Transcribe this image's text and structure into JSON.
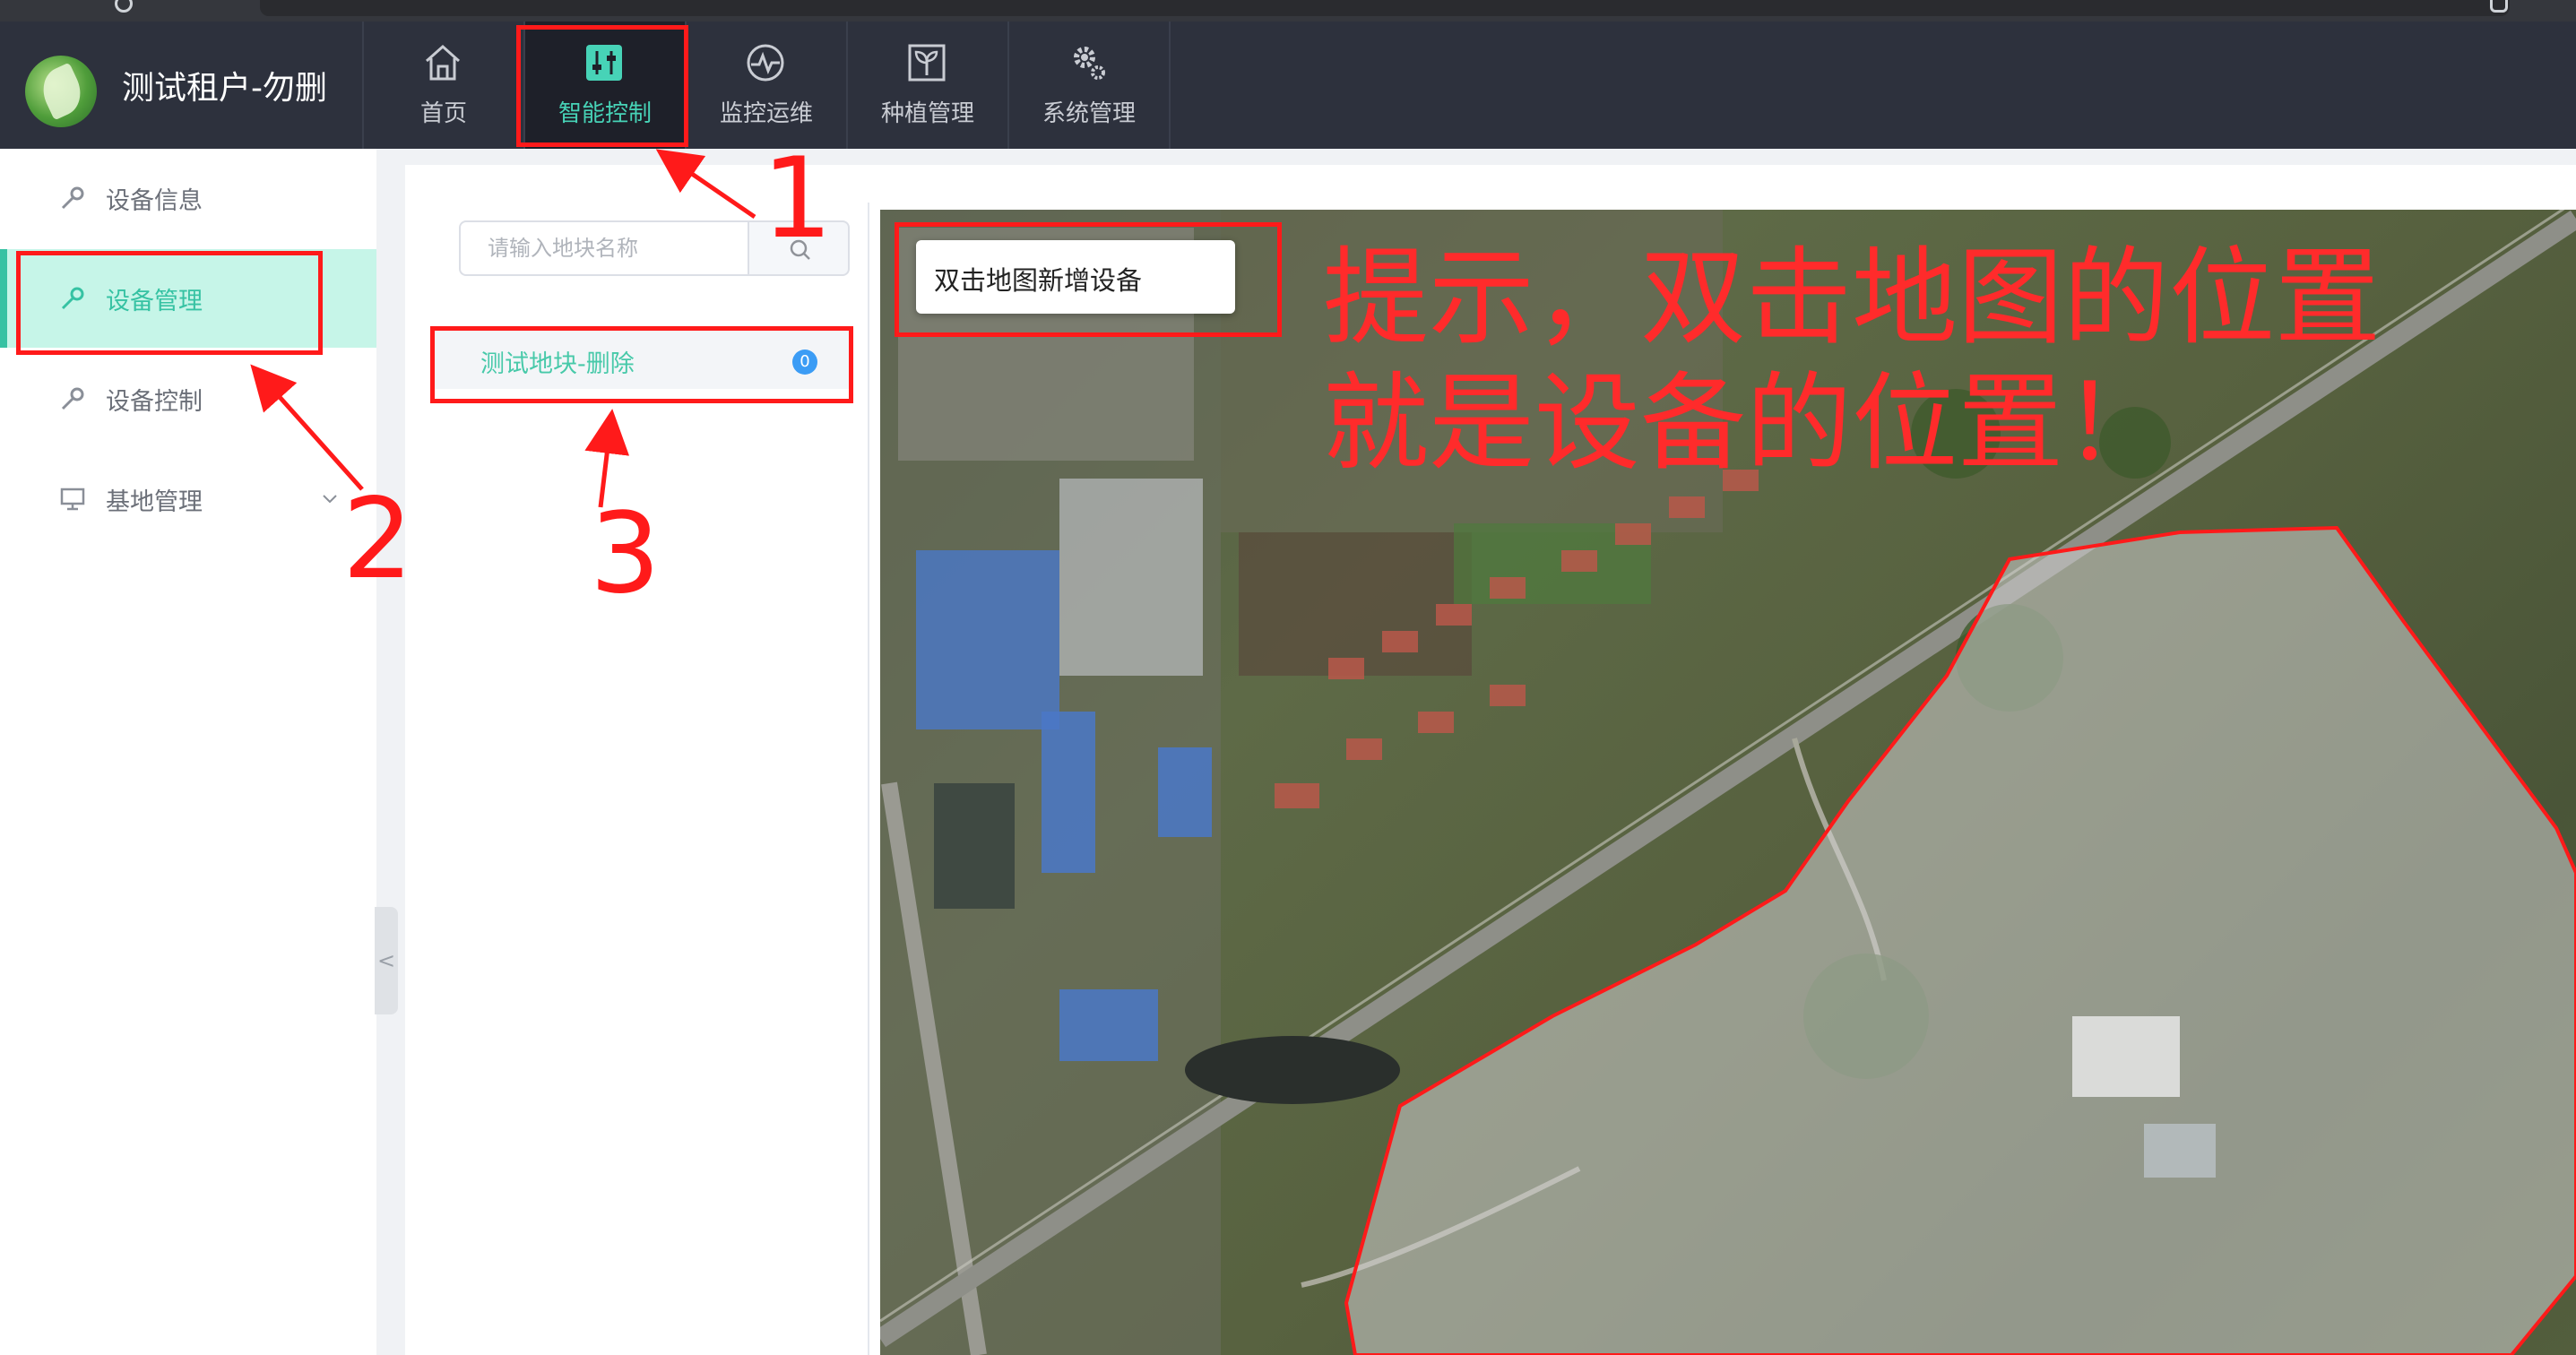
{
  "app": {
    "title": "测试租户-勿删"
  },
  "nav": {
    "tabs": [
      {
        "label": "首页",
        "icon": "home-icon"
      },
      {
        "label": "智能控制",
        "icon": "sliders-icon",
        "active": true
      },
      {
        "label": "监控运维",
        "icon": "monitor-pulse-icon"
      },
      {
        "label": "种植管理",
        "icon": "plant-icon"
      },
      {
        "label": "系统管理",
        "icon": "gears-icon"
      }
    ]
  },
  "sidebar": {
    "items": [
      {
        "label": "设备信息",
        "icon": "wrench-icon"
      },
      {
        "label": "设备管理",
        "icon": "wrench-icon",
        "active": true
      },
      {
        "label": "设备控制",
        "icon": "wrench-icon"
      },
      {
        "label": "基地管理",
        "icon": "monitor-icon",
        "expandable": true
      }
    ],
    "collapse_glyph": "<"
  },
  "plots": {
    "search_placeholder": "请输入地块名称",
    "items": [
      {
        "label": "测试地块-删除",
        "badge": "0"
      }
    ]
  },
  "map": {
    "tooltip": "双击地图新增设备"
  },
  "annotations": {
    "numbers": [
      "1",
      "2",
      "3"
    ],
    "hint_line1": "提示，双击地图的位置",
    "hint_line2": "就是设备的位置！"
  },
  "colors": {
    "nav_bg": "#2d313d",
    "accent": "#36c2a3",
    "active_menu_bg": "#c6f5e8",
    "annotation_red": "#ff1a1a",
    "badge_blue": "#3b9cf5"
  }
}
